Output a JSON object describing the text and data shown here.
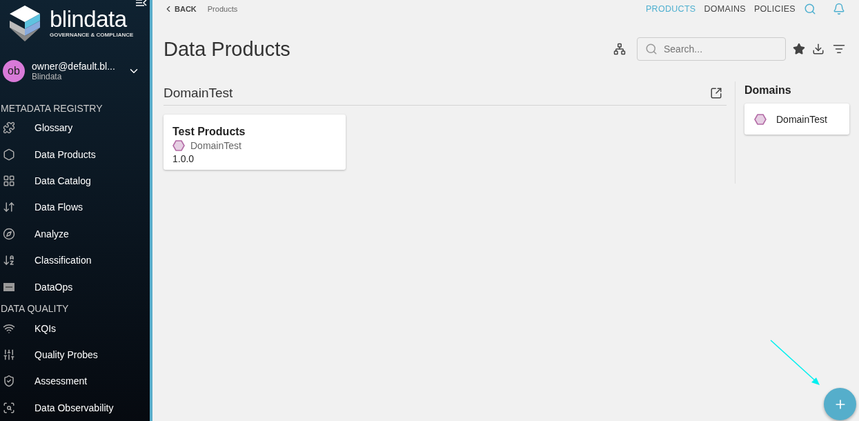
{
  "logo": {
    "name": "blindata",
    "tagline": "GOVERNANCE & COMPLIANCE"
  },
  "user": {
    "initials": "ob",
    "email": "owner@default.bl...",
    "tenant": "Blindata"
  },
  "sidebar": {
    "sections": [
      {
        "title": "METADATA REGISTRY",
        "items": [
          {
            "label": "Glossary",
            "selected": false
          },
          {
            "label": "Data Products",
            "selected": false
          },
          {
            "label": "Data Catalog",
            "selected": false
          },
          {
            "label": "Data Flows",
            "selected": false
          },
          {
            "label": "Analyze",
            "selected": false
          },
          {
            "label": "Classification",
            "selected": false
          },
          {
            "label": "DataOps",
            "selected": false
          }
        ]
      },
      {
        "title": "DATA QUALITY",
        "items": [
          {
            "label": "KQIs",
            "selected": false
          },
          {
            "label": "Quality Probes",
            "selected": false
          },
          {
            "label": "Assessment",
            "selected": false
          },
          {
            "label": "Data Observability",
            "selected": false
          }
        ]
      }
    ]
  },
  "breadcrumb": {
    "back": "BACK",
    "current": "Products"
  },
  "tabs": [
    {
      "label": "PRODUCTS",
      "selected": true
    },
    {
      "label": "DOMAINS",
      "selected": false
    },
    {
      "label": "POLICIES",
      "selected": false
    }
  ],
  "page_title": "Data Products",
  "search": {
    "placeholder": "Search..."
  },
  "groups": [
    {
      "title": "DomainTest",
      "products": [
        {
          "name": "Test Products",
          "domain": "DomainTest",
          "version": "1.0.0"
        }
      ]
    }
  ],
  "domains_panel": {
    "title": "Domains",
    "items": [
      {
        "label": "DomainTest"
      }
    ]
  }
}
